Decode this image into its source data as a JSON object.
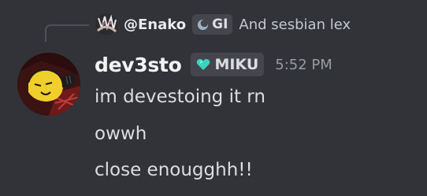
{
  "reply": {
    "author": "@Enako",
    "tag": {
      "icon": "moon-icon",
      "label": "GI"
    },
    "text": "And sesbian lex"
  },
  "message": {
    "username": "dev3sto",
    "tag": {
      "icon": "heart-icon",
      "label": "MIKU",
      "color": "#3ad5c1"
    },
    "timestamp": "5:52 PM",
    "lines": [
      "im devestoing it rn",
      "owwh",
      "close enougghh!!"
    ]
  },
  "colors": {
    "background": "#323339",
    "tag_background": "#45464d",
    "timestamp": "#949ba4"
  }
}
